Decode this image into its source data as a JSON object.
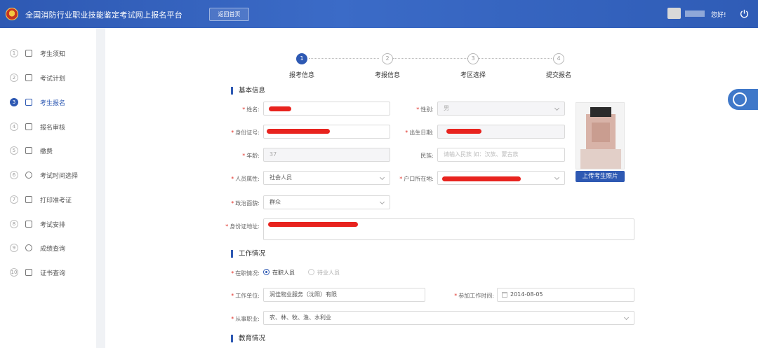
{
  "header": {
    "title": "全国消防行业职业技能鉴定考试网上报名平台",
    "home_button": "返回首页",
    "greeting": "您好!"
  },
  "sidebar": {
    "items": [
      {
        "num": "1",
        "label": "考生须知",
        "icon": "home-icon"
      },
      {
        "num": "2",
        "label": "考试计划",
        "icon": "document-icon"
      },
      {
        "num": "3",
        "label": "考生报名",
        "icon": "form-icon",
        "active": true
      },
      {
        "num": "4",
        "label": "报名审核",
        "icon": "audit-icon"
      },
      {
        "num": "5",
        "label": "缴费",
        "icon": "wallet-icon"
      },
      {
        "num": "6",
        "label": "考试时间选择",
        "icon": "alarm-icon"
      },
      {
        "num": "7",
        "label": "打印准考证",
        "icon": "printer-icon"
      },
      {
        "num": "8",
        "label": "考试安排",
        "icon": "schedule-icon"
      },
      {
        "num": "9",
        "label": "成绩查询",
        "icon": "search-icon"
      },
      {
        "num": "10",
        "label": "证书查询",
        "icon": "certificate-icon"
      }
    ]
  },
  "steps": [
    {
      "num": "1",
      "label": "报考信息",
      "active": true
    },
    {
      "num": "2",
      "label": "考报信息"
    },
    {
      "num": "3",
      "label": "考区选择"
    },
    {
      "num": "4",
      "label": "提交报名"
    }
  ],
  "sections": {
    "basic": "基本信息",
    "work": "工作情况",
    "education": "教育情况"
  },
  "form": {
    "name_label": "姓名:",
    "gender_label": "性别:",
    "gender_value": "男",
    "id_label": "身份证号:",
    "birth_label": "出生日期:",
    "age_label": "年龄:",
    "age_value": "37",
    "ethnicity_label": "民族:",
    "ethnicity_placeholder": "请输入民族 如：汉族、蒙古族",
    "category_label": "人员属性:",
    "category_value": "社会人员",
    "hukou_label": "户口所在地:",
    "political_label": "政治面貌:",
    "political_value": "群众",
    "address_label": "身份证地址:",
    "upload_photo": "上传考生照片",
    "employment_label": "在职情况:",
    "employment_options": [
      "在职人员",
      "待业人员"
    ],
    "employer_label": "工作单位:",
    "employer_value": "润佳物业服务（沈阳）有限",
    "work_start_label": "参加工作时间:",
    "work_start_value": "2014-08-05",
    "occupation_label": "从事职业:",
    "occupation_value": "农、林、牧、渔、水利业"
  },
  "colors": {
    "brand": "#2e59b3",
    "required": "#e0332b",
    "redaction": "#e8231e"
  }
}
